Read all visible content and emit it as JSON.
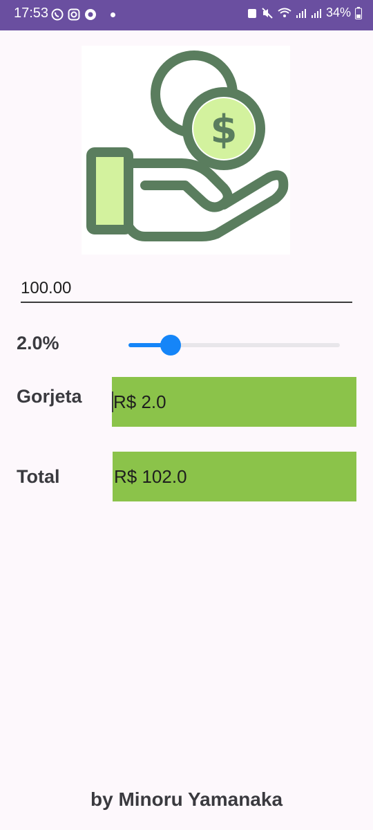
{
  "status_bar": {
    "time": "17:53",
    "battery": "34%"
  },
  "logo": {
    "icon": "hand-with-dollar-coin-icon",
    "coin_symbol": "$",
    "colors": {
      "dark_green": "#5a7d5e",
      "light_green": "#d3f29e"
    }
  },
  "bill": {
    "value": "100.00"
  },
  "tip_percent": {
    "label": "2.0%",
    "value": 2.0,
    "slider_fraction": 0.2
  },
  "tip": {
    "label": "Gorjeta",
    "value": "R$ 2.0"
  },
  "total": {
    "label": "Total",
    "value": "R$ 102.0"
  },
  "footer": {
    "credit": "by Minoru Yamanaka"
  },
  "colors": {
    "status_bar": "#6a4fa0",
    "accent": "#1585f8",
    "result_box": "#8bc34a"
  }
}
